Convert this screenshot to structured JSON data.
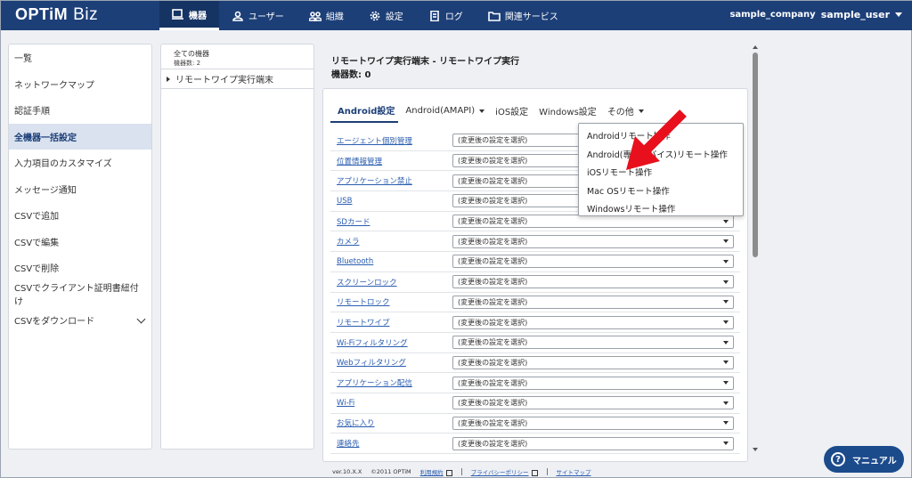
{
  "header": {
    "logo_brand": "OPTiM",
    "logo_product": "Biz",
    "nav": [
      {
        "label": "機器",
        "icon": "device-icon"
      },
      {
        "label": "ユーザー",
        "icon": "user-icon"
      },
      {
        "label": "組織",
        "icon": "organization-icon"
      },
      {
        "label": "設定",
        "icon": "gear-icon"
      },
      {
        "label": "ログ",
        "icon": "log-icon"
      },
      {
        "label": "関連サービス",
        "icon": "folder-icon"
      }
    ],
    "company": "sample_company",
    "user": "sample_user"
  },
  "sidebar": {
    "items": [
      {
        "label": "一覧"
      },
      {
        "label": "ネットワークマップ"
      },
      {
        "label": "認証手順"
      },
      {
        "label": "全機器一括設定"
      },
      {
        "label": "入力項目のカスタマイズ"
      },
      {
        "label": "メッセージ通知"
      },
      {
        "label": "CSVで追加"
      },
      {
        "label": "CSVで編集"
      },
      {
        "label": "CSVで削除"
      },
      {
        "label": "CSVでクライアント証明書紐付け"
      },
      {
        "label": "CSVをダウンロード"
      }
    ]
  },
  "tree": {
    "root_label": "全ての機器",
    "root_count": "機器数: 2",
    "node_label": "リモートワイプ実行端末"
  },
  "main": {
    "title": "リモートワイプ実行端末 - リモートワイプ実行",
    "count": "機器数: 0",
    "tabs": [
      {
        "label": "Android設定"
      },
      {
        "label": "Android(AMAPI)"
      },
      {
        "label": "iOS設定"
      },
      {
        "label": "Windows設定"
      },
      {
        "label": "その他"
      }
    ],
    "select_placeholder": "(変更後の設定を選択)",
    "rows": [
      {
        "label": "エージェント個別管理"
      },
      {
        "label": "位置情報管理"
      },
      {
        "label": "アプリケーション禁止"
      },
      {
        "label": "USB"
      },
      {
        "label": "SDカード"
      },
      {
        "label": "カメラ"
      },
      {
        "label": "Bluetooth"
      },
      {
        "label": "スクリーンロック"
      },
      {
        "label": "リモートロック"
      },
      {
        "label": "リモートワイプ"
      },
      {
        "label": "Wi-Fiフィルタリング"
      },
      {
        "label": "Webフィルタリング"
      },
      {
        "label": "アプリケーション配信"
      },
      {
        "label": "Wi-Fi"
      },
      {
        "label": "お気に入り"
      },
      {
        "label": "連絡先"
      }
    ]
  },
  "menu": {
    "items": [
      {
        "label": "Androidリモート操作"
      },
      {
        "label": "Android(専用デバイス)リモート操作"
      },
      {
        "label": "iOSリモート操作"
      },
      {
        "label": "Mac OSリモート操作"
      },
      {
        "label": "Windowsリモート操作"
      }
    ]
  },
  "footer": {
    "version": "ver.10.X.X",
    "copyright": "©2011 OPTiM",
    "terms": "利用規約",
    "privacy": "プライバシーポリシー",
    "sitemap": "サイトマップ"
  },
  "manual_button": "マニュアル",
  "colors": {
    "header": "#1c3f78",
    "accent": "#1c3f78",
    "arrow": "#e8101c",
    "link": "#2a5db0"
  }
}
